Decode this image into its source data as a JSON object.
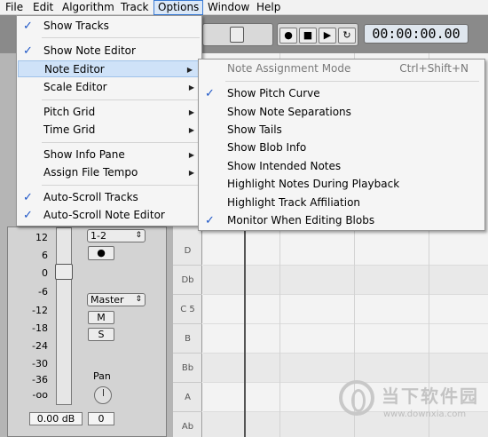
{
  "menubar": {
    "items": [
      "File",
      "Edit",
      "Algorithm",
      "Track",
      "Options",
      "Window",
      "Help"
    ],
    "active": "Options"
  },
  "toolbar": {
    "record_glyph": "●",
    "stop_glyph": "■",
    "play_glyph": "▶",
    "loop_glyph": "↻",
    "timecode": "00:00:00.00"
  },
  "options_menu": {
    "items": [
      {
        "label": "Show Tracks",
        "checked": true
      },
      {
        "label": "Show Note Editor",
        "checked": true
      },
      {
        "label": "Note Editor",
        "submenu": true,
        "highlighted": true
      },
      {
        "label": "Scale Editor",
        "submenu": true
      },
      {
        "label": "Pitch Grid",
        "submenu": true
      },
      {
        "label": "Time Grid",
        "submenu": true
      },
      {
        "label": "Show Info Pane",
        "submenu": true
      },
      {
        "label": "Assign File Tempo",
        "submenu": true
      },
      {
        "label": "Auto-Scroll Tracks",
        "checked": true
      },
      {
        "label": "Auto-Scroll Note Editor",
        "checked": true
      }
    ]
  },
  "note_editor_submenu": {
    "items": [
      {
        "label": "Note Assignment Mode",
        "shortcut": "Ctrl+Shift+N",
        "disabled": true
      },
      {
        "label": "Show Pitch Curve",
        "checked": true
      },
      {
        "label": "Show Note Separations"
      },
      {
        "label": "Show Tails"
      },
      {
        "label": "Show Blob Info"
      },
      {
        "label": "Show Intended Notes"
      },
      {
        "label": "Highlight Notes During Playback"
      },
      {
        "label": "Highlight Track Affiliation"
      },
      {
        "label": "Monitor When Editing Blobs",
        "checked": true
      }
    ]
  },
  "strip": {
    "db_scale": [
      "12",
      "6",
      "0",
      "-6",
      "-12",
      "-18",
      "-24",
      "-30",
      "-36",
      "-oo"
    ],
    "input_select": "1-2",
    "output_select": "Master",
    "mute_label": "M",
    "solo_label": "S",
    "pan_label": "Pan",
    "gain_readout": "0.00 dB",
    "pan_readout": "0",
    "record_glyph": "●",
    "select_arrow": "⇕"
  },
  "piano_keys": [
    "D",
    "Db",
    "C 5",
    "B",
    "Bb",
    "A",
    "Ab"
  ],
  "glyphs": {
    "check": "✓",
    "submenu_arrow": "▶"
  },
  "watermark": {
    "text": "当下软件园",
    "url": "www.downxia.com"
  }
}
